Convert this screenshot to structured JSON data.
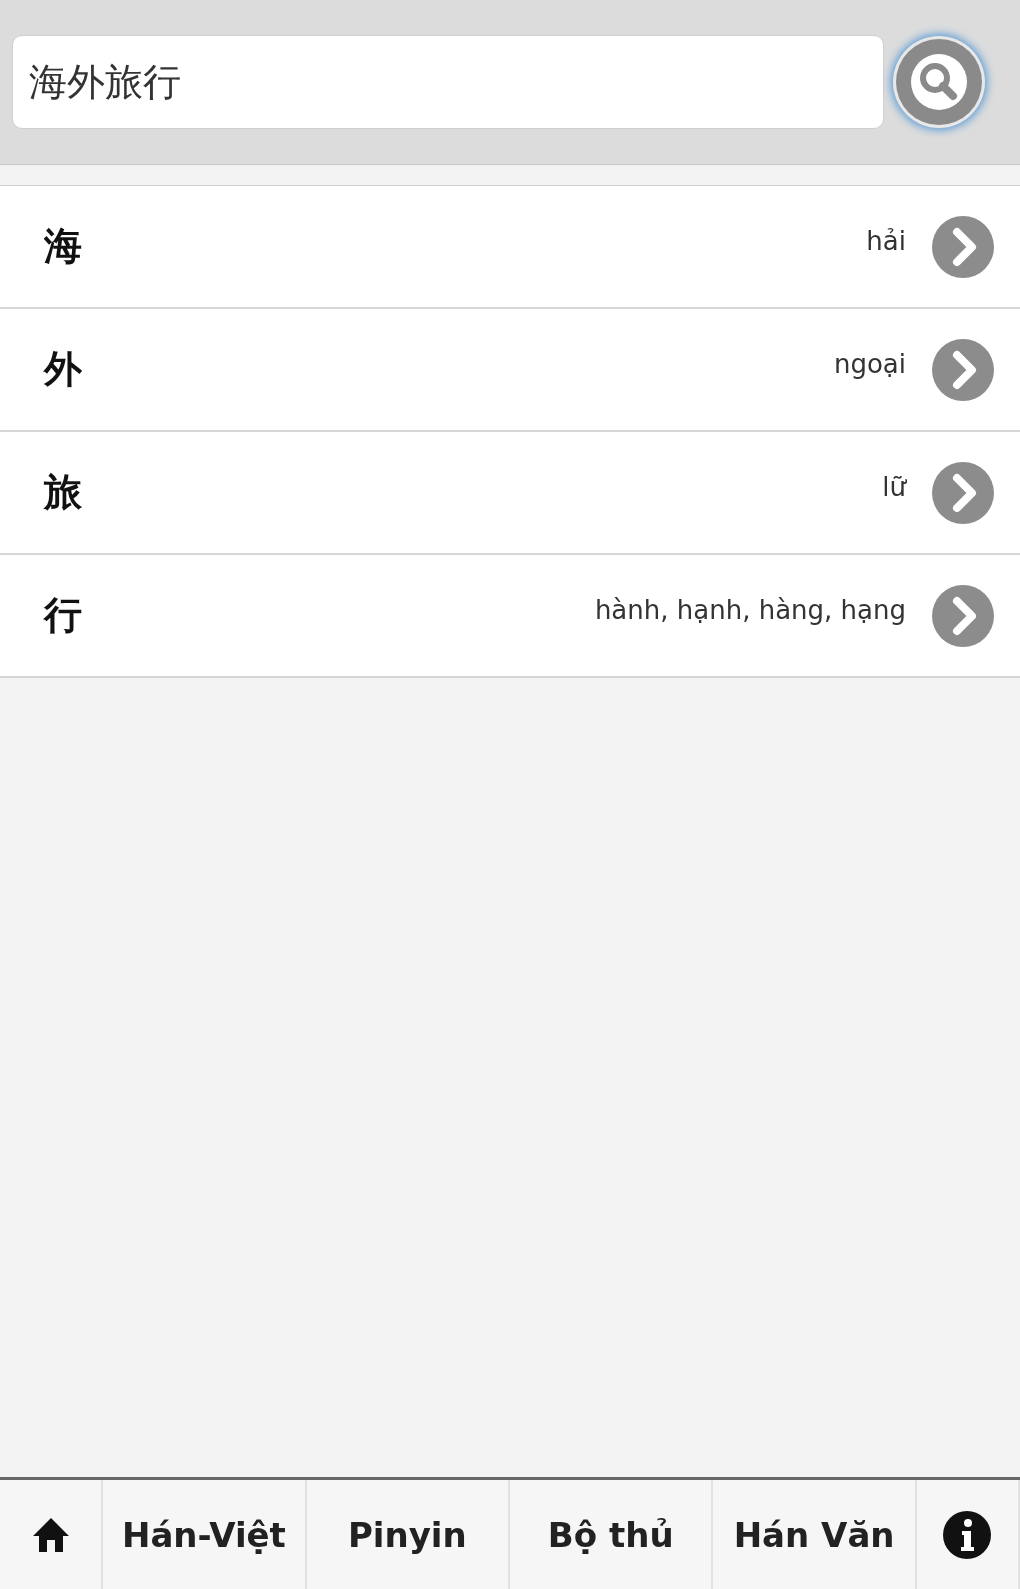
{
  "search": {
    "value": "海外旅行"
  },
  "results": [
    {
      "character": "海",
      "reading": "hải"
    },
    {
      "character": "外",
      "reading": "ngoại"
    },
    {
      "character": "旅",
      "reading": "lữ"
    },
    {
      "character": "行",
      "reading": "hành, hạnh, hàng, hạng"
    }
  ],
  "nav_bar": [
    {
      "kind": "home",
      "selected": false
    },
    {
      "kind": "text",
      "label": "Hán-Việt",
      "selected": false
    },
    {
      "kind": "text",
      "label": "Pinyin",
      "selected": false
    },
    {
      "kind": "text",
      "label": "Bộ thủ",
      "selected": false
    },
    {
      "kind": "text",
      "label": "Hán Văn",
      "selected": false
    },
    {
      "kind": "info",
      "selected": false
    }
  ]
}
